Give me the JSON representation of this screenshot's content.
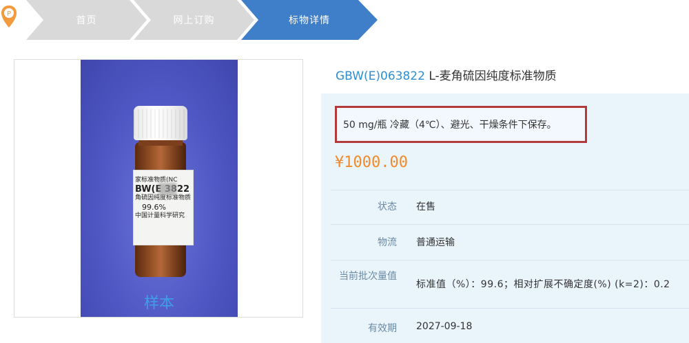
{
  "breadcrumb": {
    "items": [
      {
        "label": "首页",
        "active": false
      },
      {
        "label": "网上订购",
        "active": false
      },
      {
        "label": "标物详情",
        "active": true
      }
    ],
    "colors": {
      "inactive": "#d9d9d9",
      "active": "#3f7fc9"
    }
  },
  "product": {
    "code": "GBW(E)063822",
    "name": "L-麦角硫因纯度标准物质",
    "spec": "50 mg/瓶 冷藏（4℃）、避光、干燥条件下保存。",
    "price": "¥1000.00",
    "sample_caption": "样本",
    "vial_label": {
      "line1": "家标准物质(NC",
      "line2": "BW(E  3822",
      "line3": "角硫因纯度标准物质",
      "line4": "99.6%",
      "line5": "中国计量科学研究"
    },
    "attributes": [
      {
        "key": "状态",
        "value": "在售"
      },
      {
        "key": "物流",
        "value": "普通运输"
      },
      {
        "key": "当前批次量值",
        "value": "标准值（%）：99.6；相对扩展不确定度(%) (k=2)：0.2"
      },
      {
        "key": "有效期",
        "value": "2027-09-18"
      }
    ]
  },
  "icons": {
    "location": "map-pin-icon"
  }
}
